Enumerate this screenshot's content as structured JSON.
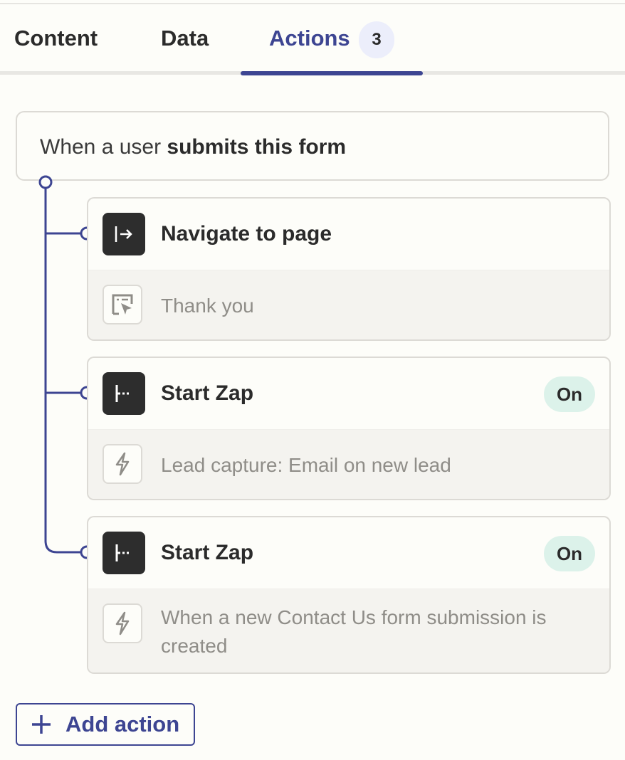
{
  "tabs": [
    {
      "label": "Content",
      "active": false
    },
    {
      "label": "Data",
      "active": false
    },
    {
      "label": "Actions",
      "active": true,
      "badge": "3"
    }
  ],
  "trigger": {
    "prefix": "When a user ",
    "emphasis": "submits this form"
  },
  "actions": [
    {
      "icon": "navigate-icon",
      "title": "Navigate to page",
      "status": null,
      "detail_icon": "page-cursor-icon",
      "detail": "Thank you"
    },
    {
      "icon": "zap-icon",
      "title": "Start Zap",
      "status": "On",
      "detail_icon": "lightning-icon",
      "detail": "Lead capture: Email on new lead"
    },
    {
      "icon": "zap-icon",
      "title": "Start Zap",
      "status": "On",
      "detail_icon": "lightning-icon",
      "detail": "When a new Contact Us form submission is created"
    }
  ],
  "add_action": {
    "label": "Add action"
  },
  "colors": {
    "accent": "#3d4592",
    "status_bg": "#dcf2ea",
    "icon_bg": "#2d2d2d"
  }
}
